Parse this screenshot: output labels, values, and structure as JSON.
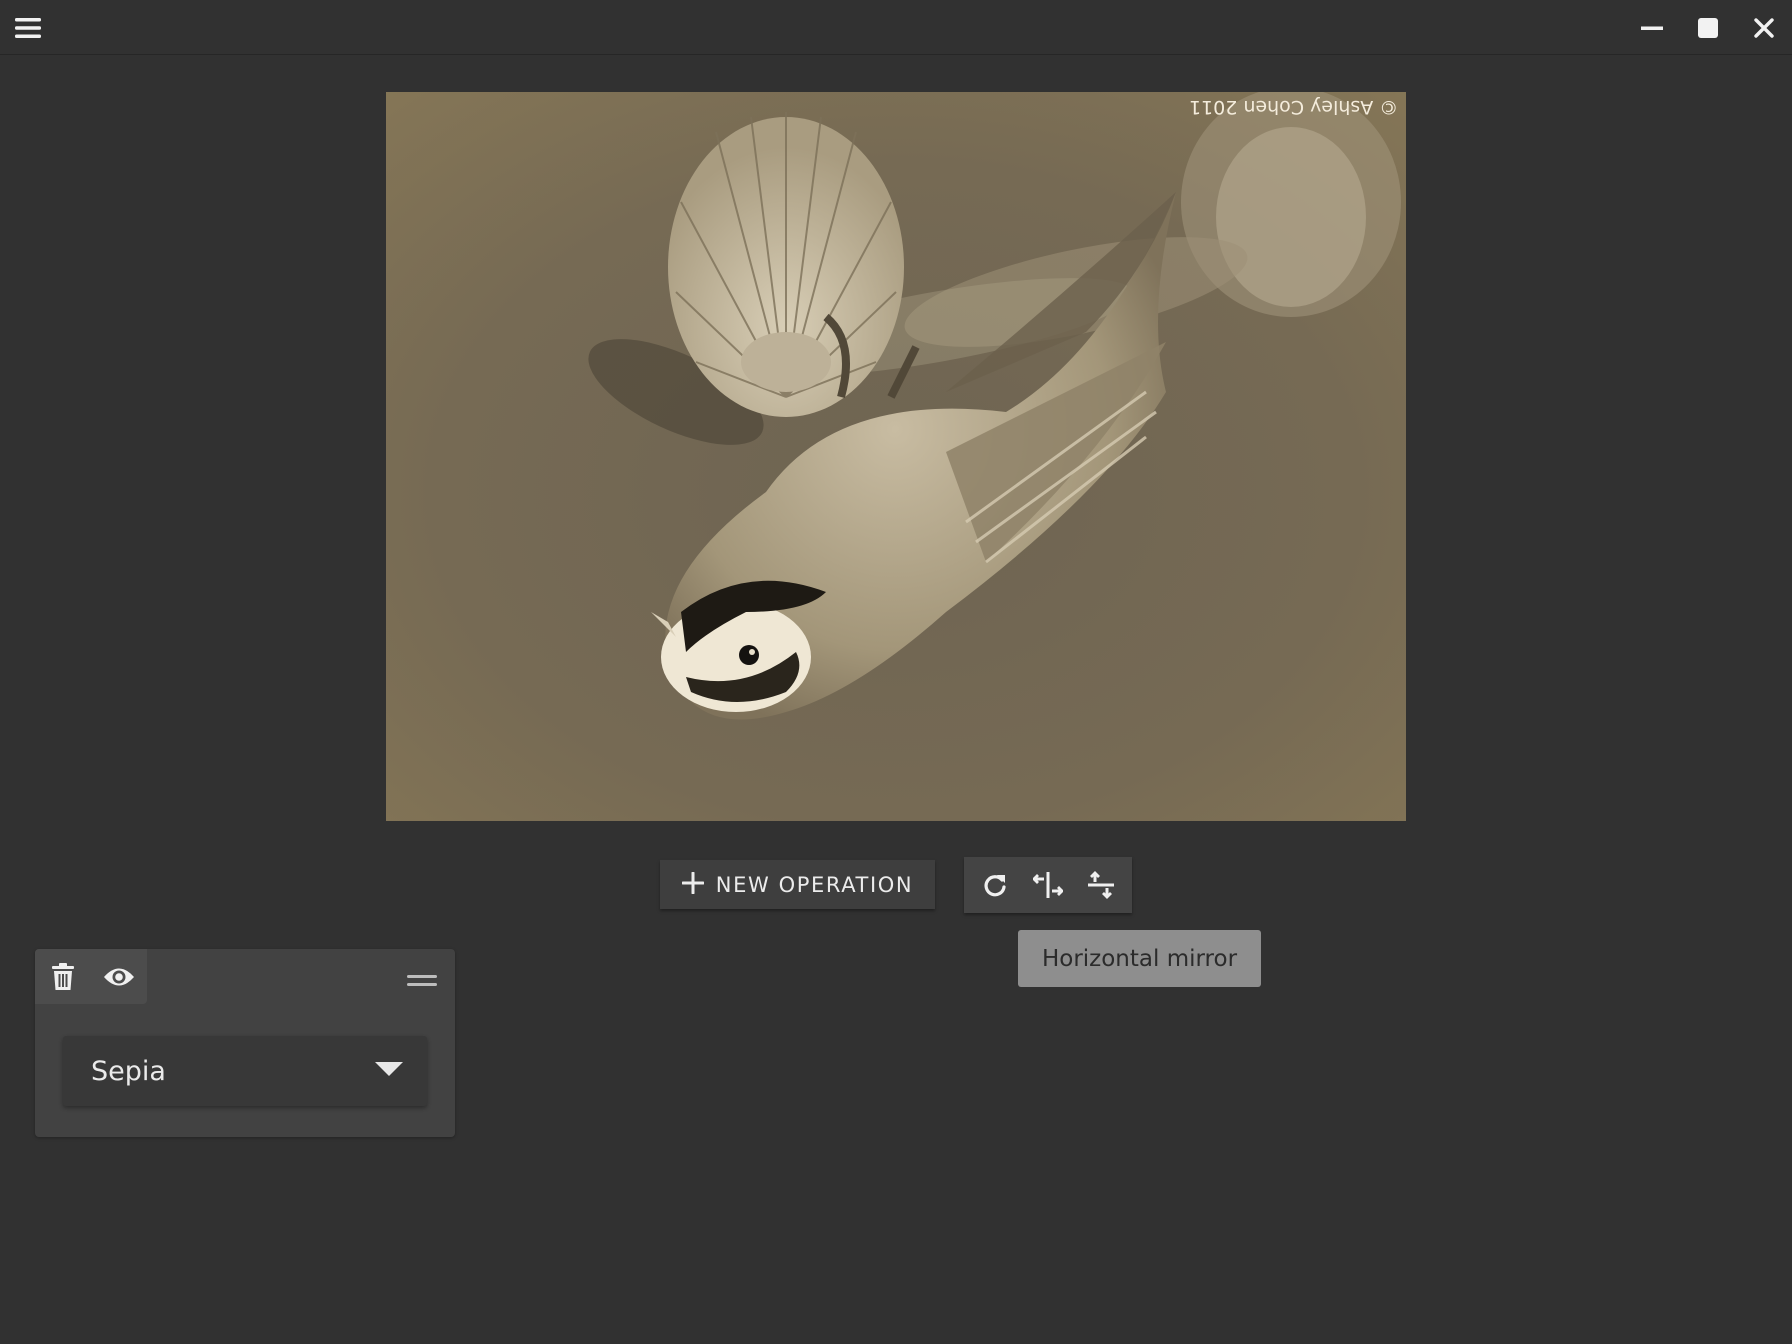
{
  "window": {
    "menu_icon": "hamburger-menu-icon",
    "minimize_icon": "minimize-icon",
    "maximize_icon": "maximize-icon",
    "close_icon": "close-icon"
  },
  "image": {
    "watermark": "© Ashley Cohen 2011",
    "orientation": "upside-down",
    "filter_tone": "sepia"
  },
  "toolbar": {
    "new_operation_label": "NEW OPERATION",
    "new_operation_icon": "plus-icon",
    "rotate_icon": "rotate-clockwise-icon",
    "horizontal_mirror_icon": "horizontal-mirror-icon",
    "vertical_mirror_icon": "vertical-mirror-icon"
  },
  "tooltip": {
    "text": "Horizontal mirror"
  },
  "operations": [
    {
      "type": "Sepia",
      "delete_icon": "trash-icon",
      "visibility_icon": "eye-icon",
      "drag_icon": "drag-handle-icon",
      "dropdown_icon": "caret-down-icon"
    }
  ],
  "colors": {
    "background": "#313131",
    "card": "#424242",
    "tooltip": "#8e8e8e"
  }
}
